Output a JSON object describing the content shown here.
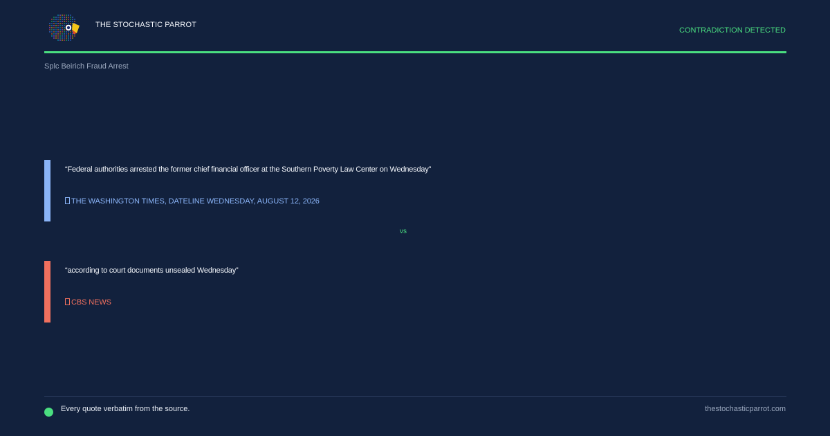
{
  "header": {
    "brand_name": "THE STOCHASTIC PARROT",
    "status": "CONTRADICTION DETECTED"
  },
  "topic": "Splc Beirich Fraud Arrest",
  "quotes": [
    {
      "text": "“Federal authorities arrested the former chief financial officer at the Southern Poverty Law Center on Wednesday”",
      "source": "THE WASHINGTON TIMES, DATELINE WEDNESDAY, AUGUST 12, 2026",
      "icon": "document-icon"
    },
    {
      "text": "“according to court documents unsealed Wednesday”",
      "source": "CBS NEWS",
      "icon": "document-icon"
    }
  ],
  "separator": "vs",
  "footer": {
    "note": "Every quote verbatim from the source.",
    "site": "thestochasticparrot.com"
  },
  "colors": {
    "background": "#12213d",
    "accent": "#4ade80",
    "quote_a": "#8ab4f8",
    "quote_b": "#f0705e"
  }
}
